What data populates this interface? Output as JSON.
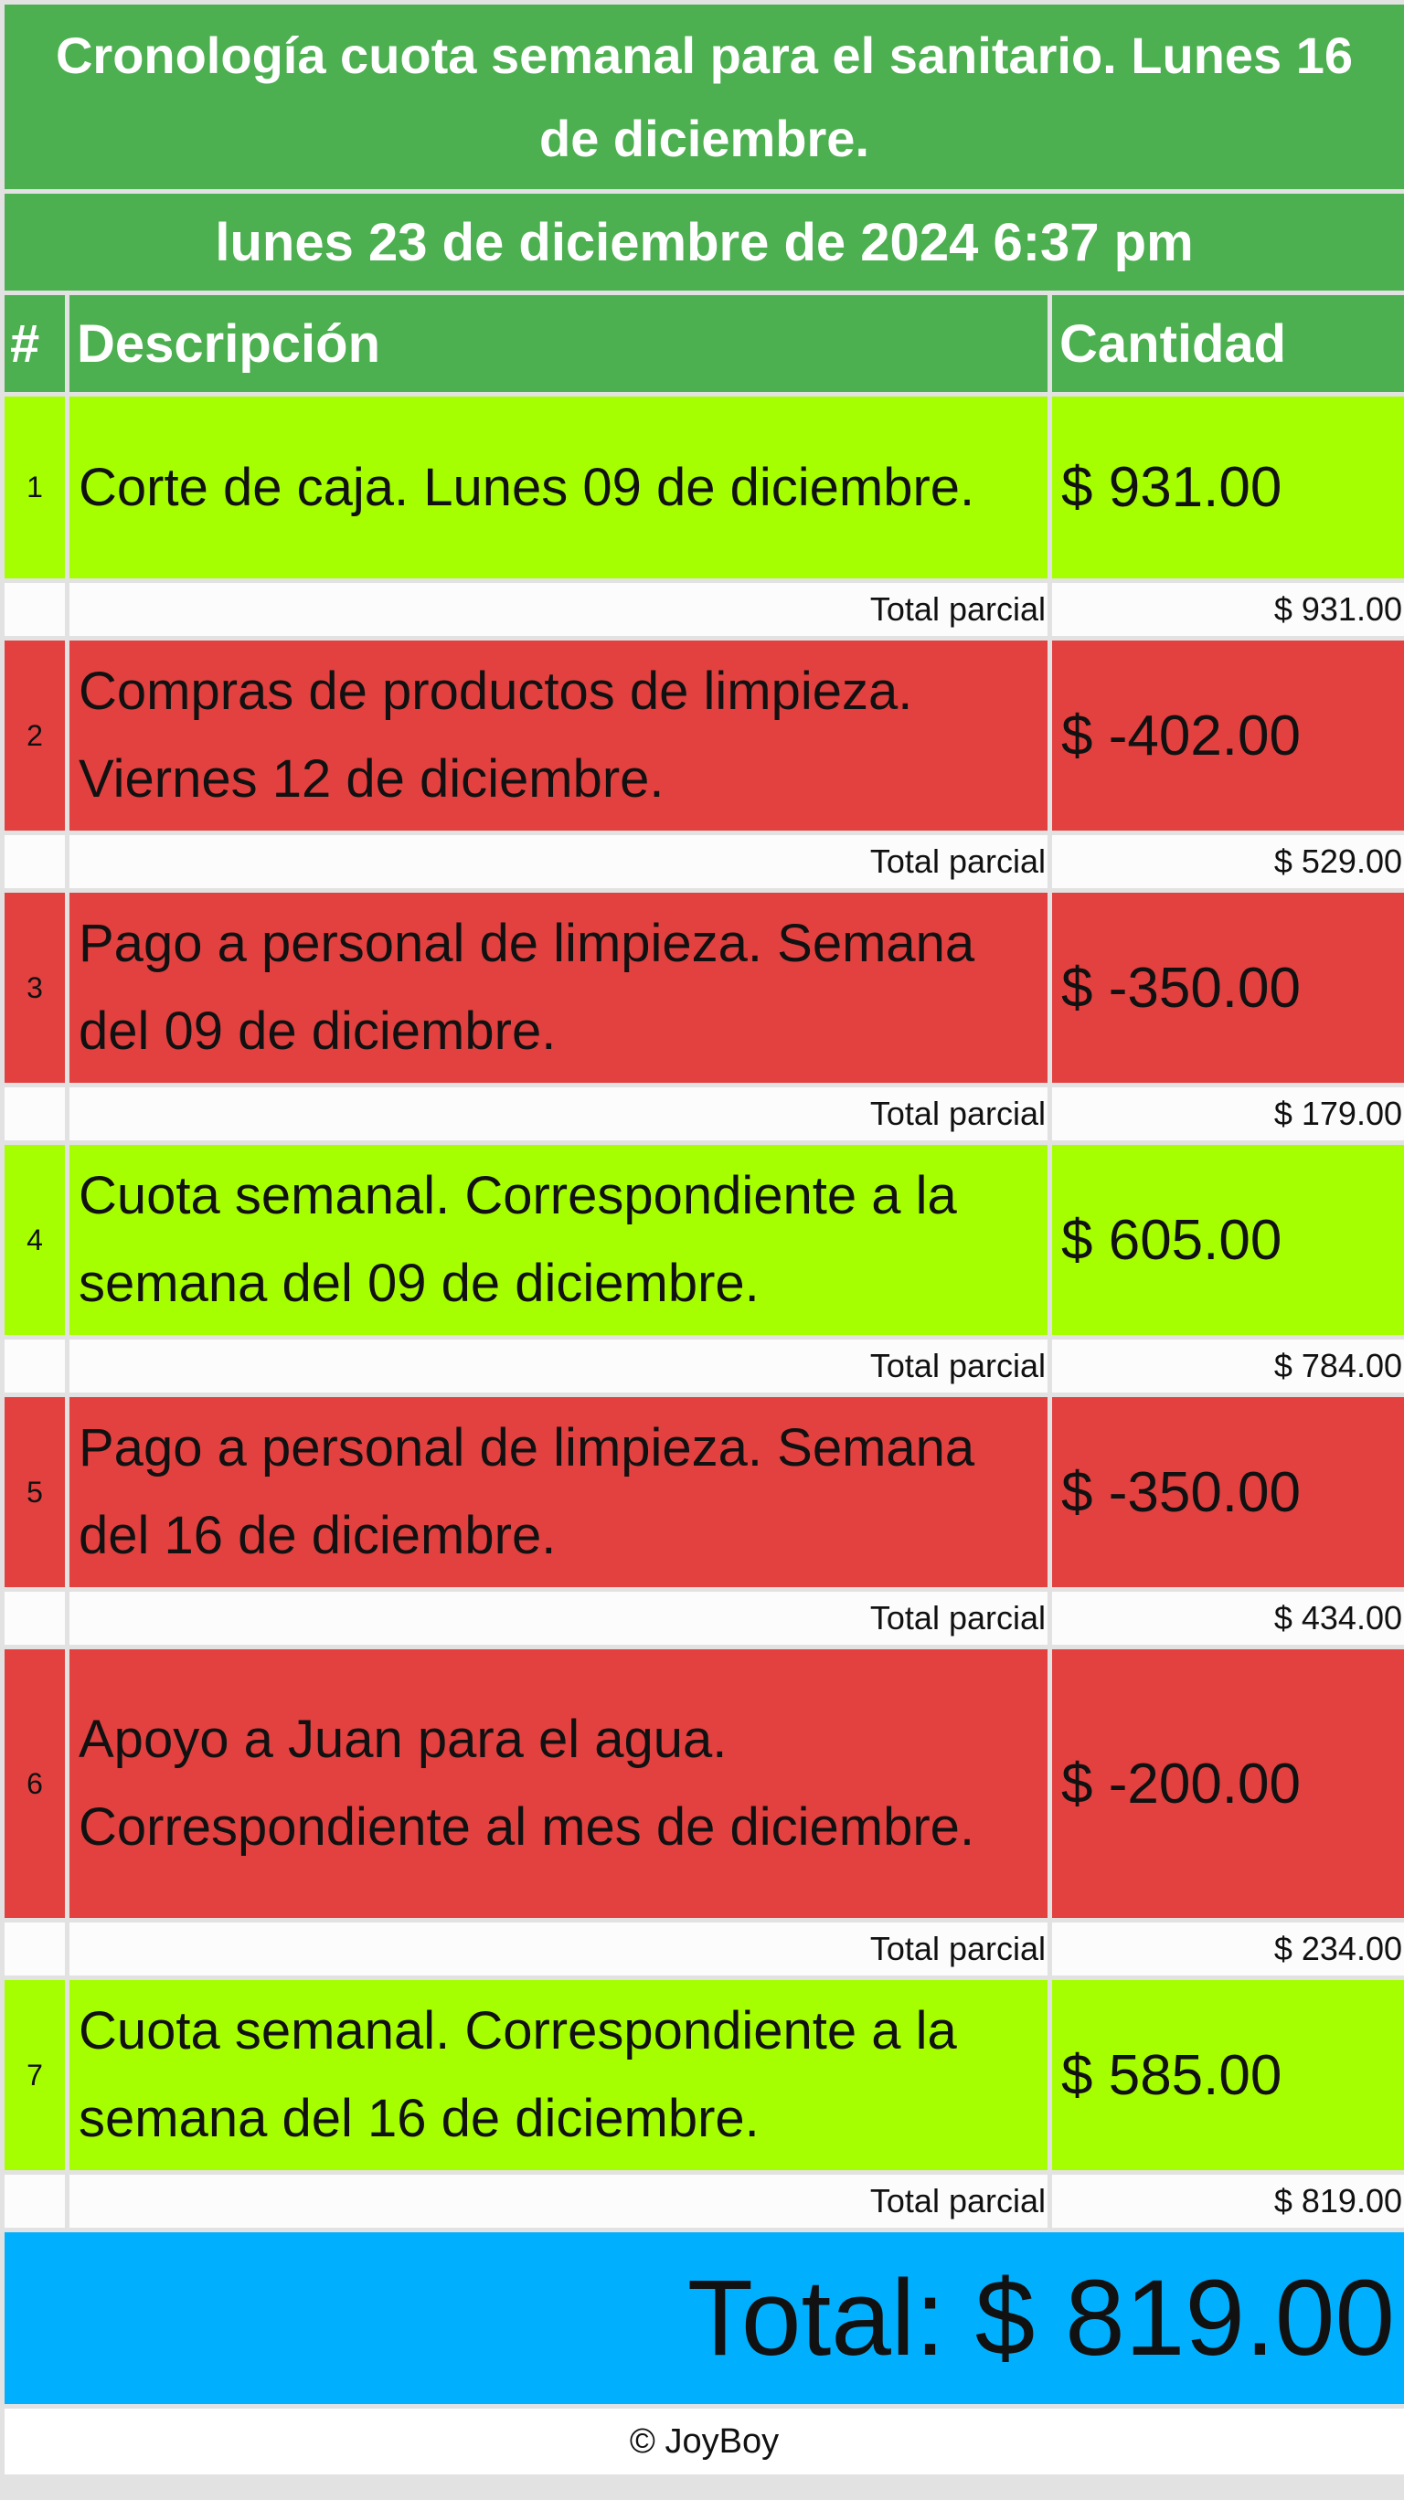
{
  "header": {
    "title": "Cronología cuota semanal para el sanitario. Lunes 16 de diciembre.",
    "date": "lunes 23 de diciembre de 2024 6:37 pm"
  },
  "columns": {
    "number": "#",
    "description": "Descripción",
    "amount": "Cantidad"
  },
  "subtotal_label": "Total parcial",
  "rows": [
    {
      "number": "1",
      "description": "Corte de caja. Lunes 09 de diciembre.",
      "amount": "$ 931.00",
      "subtotal": "$ 931.00",
      "type": "income"
    },
    {
      "number": "2",
      "description": "Compras de productos de limpieza. Viernes 12 de diciembre.",
      "amount": "$ -402.00",
      "subtotal": "$ 529.00",
      "type": "expense"
    },
    {
      "number": "3",
      "description": "Pago a personal de limpieza. Semana del 09 de diciembre.",
      "amount": "$ -350.00",
      "subtotal": "$ 179.00",
      "type": "expense"
    },
    {
      "number": "4",
      "description": "Cuota semanal. Correspondiente a la semana del 09 de diciembre.",
      "amount": "$ 605.00",
      "subtotal": "$ 784.00",
      "type": "income"
    },
    {
      "number": "5",
      "description": "Pago a personal de limpieza. Semana del 16 de diciembre.",
      "amount": "$ -350.00",
      "subtotal": "$ 434.00",
      "type": "expense"
    },
    {
      "number": "6",
      "description": "Apoyo a Juan para el agua. Correspondiente al mes de diciembre.",
      "amount": "$ -200.00",
      "subtotal": "$ 234.00",
      "type": "expense"
    },
    {
      "number": "7",
      "description": "Cuota semanal. Correspondiente a la semana del 16 de diciembre.",
      "amount": "$ 585.00",
      "subtotal": "$ 819.00",
      "type": "income"
    }
  ],
  "total": "Total: $ 819.00",
  "footer": "© JoyBoy",
  "colors": {
    "header_green": "#4caf50",
    "income_green": "#a6ff00",
    "expense_red": "#e34040",
    "total_blue": "#00b0ff"
  }
}
